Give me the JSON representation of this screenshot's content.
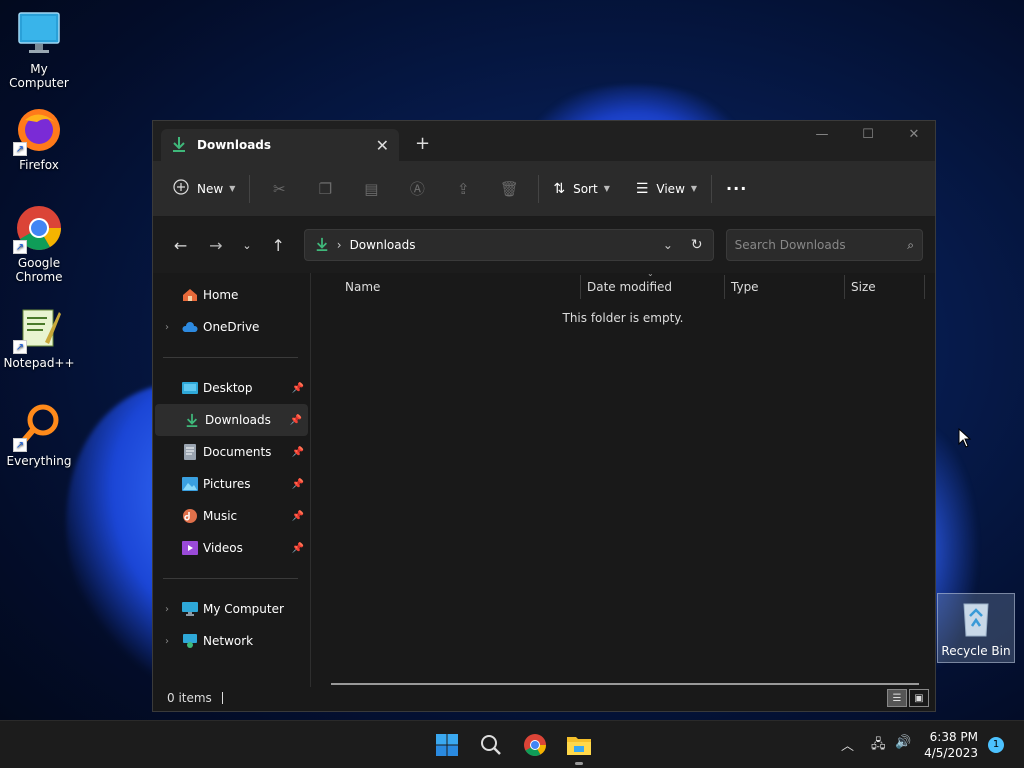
{
  "desktop": {
    "icons": [
      {
        "label": "My Computer"
      },
      {
        "label": "Firefox"
      },
      {
        "label": "Google Chrome"
      },
      {
        "label": "Notepad++"
      },
      {
        "label": "Everything"
      }
    ],
    "recycle_bin": {
      "label": "Recycle Bin"
    }
  },
  "window": {
    "tab": {
      "title": "Downloads"
    },
    "toolbar": {
      "new_label": "New",
      "sort_label": "Sort",
      "view_label": "View"
    },
    "address": {
      "crumb": "Downloads",
      "search_placeholder": "Search Downloads"
    },
    "sidebar": {
      "items": [
        {
          "label": "Home"
        },
        {
          "label": "OneDrive"
        },
        {
          "label": "Desktop"
        },
        {
          "label": "Downloads"
        },
        {
          "label": "Documents"
        },
        {
          "label": "Pictures"
        },
        {
          "label": "Music"
        },
        {
          "label": "Videos"
        },
        {
          "label": "My Computer"
        },
        {
          "label": "Network"
        }
      ]
    },
    "columns": {
      "name": "Name",
      "date_modified": "Date modified",
      "type": "Type",
      "size": "Size"
    },
    "empty_message": "This folder is empty.",
    "status": {
      "items": "0 items"
    }
  },
  "taskbar": {
    "clock": {
      "time": "6:38 PM",
      "date": "4/5/2023"
    },
    "notification_count": "1"
  },
  "colors": {
    "accent": "#4cc2ff",
    "download_green": "#3fb87a",
    "window_bg": "#191919"
  }
}
